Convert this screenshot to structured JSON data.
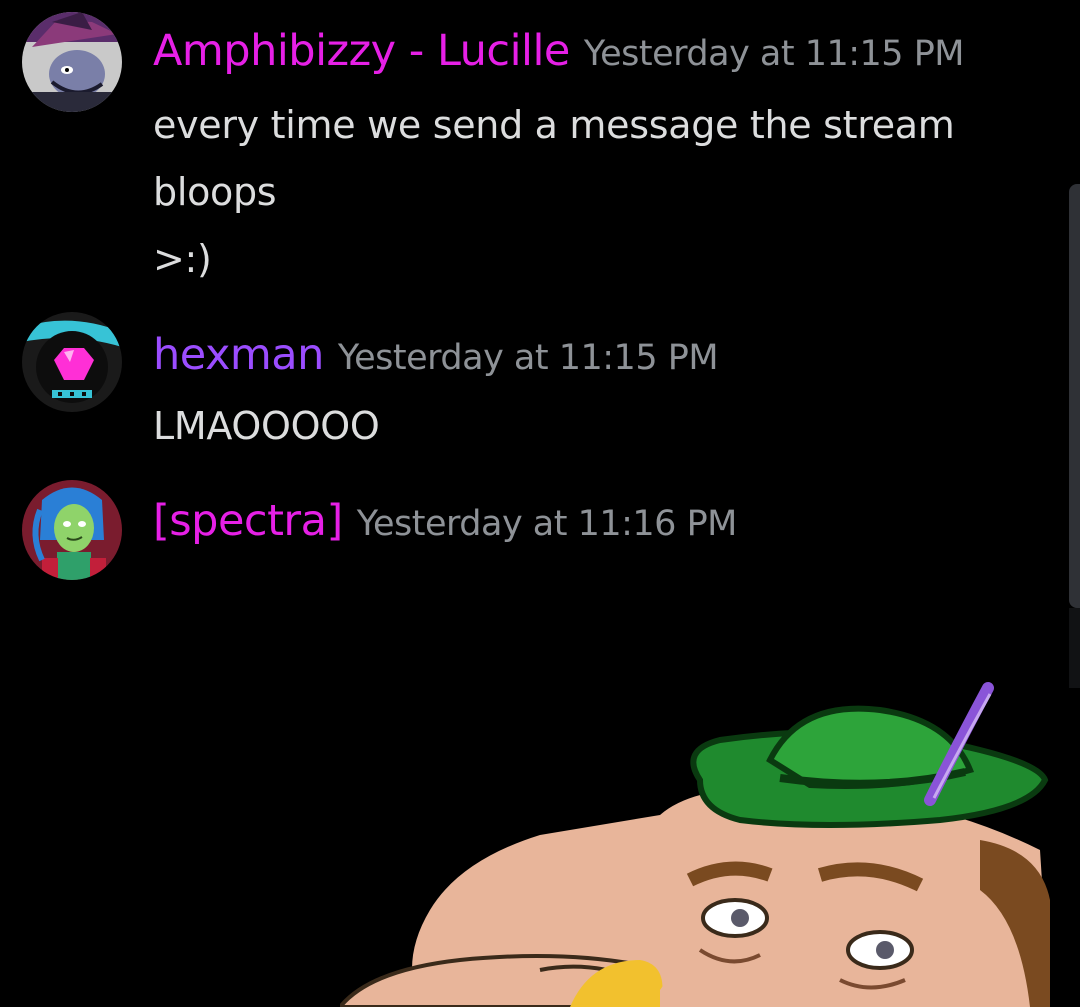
{
  "messages": [
    {
      "username": "Amphibizzy - Lucille",
      "username_color": "#e620e6",
      "timestamp": "Yesterday at 11:15 PM",
      "lines": [
        "every time we send a message the stream",
        "bloops",
        ">:)"
      ],
      "avatar_icon": "witch-hat-character-avatar"
    },
    {
      "username": "hexman",
      "username_color": "#9b4dff",
      "timestamp": "Yesterday at 11:15 PM",
      "lines": [
        "LMAOOOOO"
      ],
      "avatar_icon": "pink-gem-character-avatar"
    },
    {
      "username": "[spectra]",
      "username_color": "#e620e6",
      "timestamp": "Yesterday at 11:16 PM",
      "lines": [],
      "avatar_icon": "green-haired-character-avatar"
    }
  ],
  "sticker_image": "pixel-art-man-with-green-feathered-hat",
  "colors": {
    "background": "#000000",
    "message_text": "#dcddde",
    "timestamp_text": "#8e9297"
  }
}
